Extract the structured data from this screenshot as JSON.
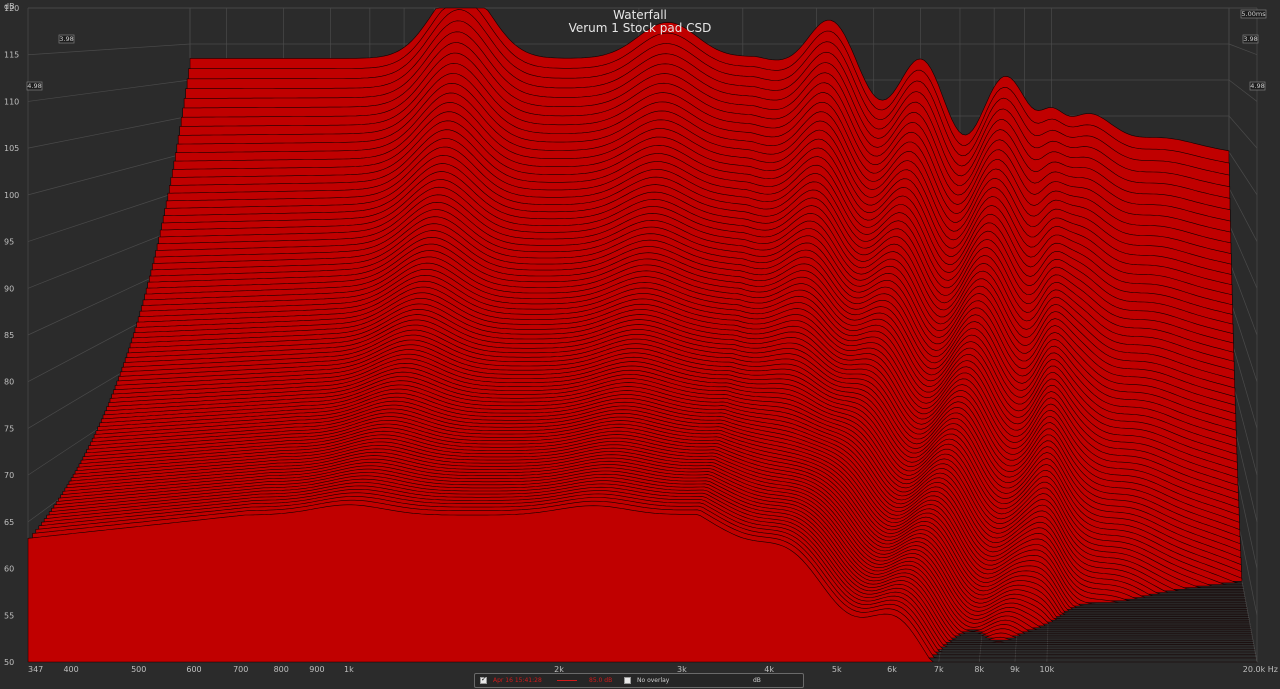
{
  "chart_data": {
    "type": "waterfall",
    "title": "Waterfall",
    "subtitle": "Verum 1 Stock pad CSD",
    "ylabel": "dB",
    "ylim": [
      50,
      120
    ],
    "y_ticks": [
      "50",
      "55",
      "60",
      "65",
      "70",
      "75",
      "80",
      "85",
      "90",
      "95",
      "100",
      "105",
      "110",
      "115",
      "120"
    ],
    "x_scale": "log",
    "xlim": [
      347,
      20000
    ],
    "x_ticks": [
      {
        "f": 347,
        "label": "347"
      },
      {
        "f": 400,
        "label": "400"
      },
      {
        "f": 500,
        "label": "500"
      },
      {
        "f": 600,
        "label": "600"
      },
      {
        "f": 700,
        "label": "700"
      },
      {
        "f": 800,
        "label": "800"
      },
      {
        "f": 900,
        "label": "900"
      },
      {
        "f": 1000,
        "label": "1k"
      },
      {
        "f": 2000,
        "label": "2k"
      },
      {
        "f": 3000,
        "label": "3k"
      },
      {
        "f": 4000,
        "label": "4k"
      },
      {
        "f": 5000,
        "label": "5k"
      },
      {
        "f": 6000,
        "label": "6k"
      },
      {
        "f": 7000,
        "label": "7k"
      },
      {
        "f": 8000,
        "label": "8k"
      },
      {
        "f": 9000,
        "label": "9k"
      },
      {
        "f": 10000,
        "label": "10k"
      },
      {
        "f": 20000,
        "label": "20.0k Hz"
      }
    ],
    "time_ticks_left": [
      "3.98",
      "4.98"
    ],
    "time_ticks_right": [
      "5.00ms",
      "3.98",
      "4.98"
    ],
    "slice_color": "#c00000",
    "slice_line_color": "#140000",
    "grid": true,
    "legend_position": "bottom-center",
    "series": [
      {
        "name": "Apr 16 15:41:28",
        "value": "85.0 dB"
      }
    ]
  },
  "legend": {
    "series_name": "Apr 16 15:41:28",
    "series_value": "85.0 dB",
    "overlay_label": "No overlay",
    "unit": "dB"
  }
}
